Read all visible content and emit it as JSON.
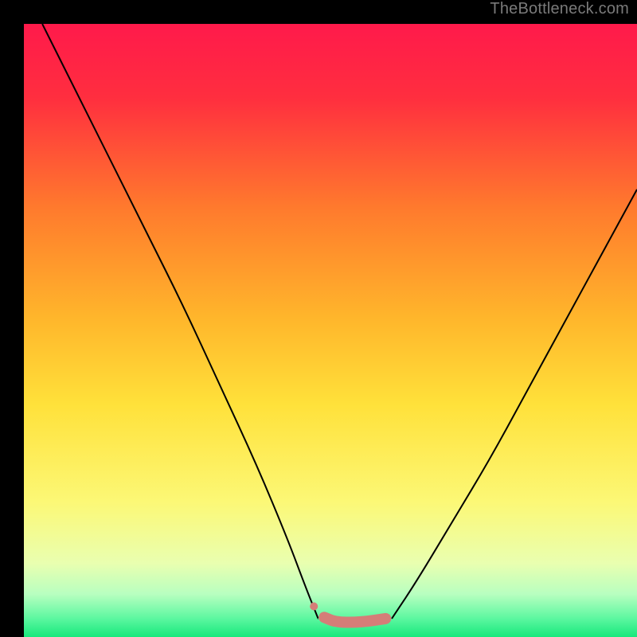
{
  "watermark": "TheBottleneck.com",
  "chart_data": {
    "type": "line",
    "title": "",
    "xlabel": "",
    "ylabel": "",
    "xlim": [
      0,
      100
    ],
    "ylim": [
      0,
      100
    ],
    "background_gradient": {
      "stops": [
        {
          "pct": 0,
          "color": "#ff1a4b"
        },
        {
          "pct": 12,
          "color": "#ff2e3f"
        },
        {
          "pct": 30,
          "color": "#ff7a2d"
        },
        {
          "pct": 48,
          "color": "#ffb62b"
        },
        {
          "pct": 62,
          "color": "#ffe13a"
        },
        {
          "pct": 78,
          "color": "#fcf876"
        },
        {
          "pct": 88,
          "color": "#e9ffb0"
        },
        {
          "pct": 93,
          "color": "#b8ffc0"
        },
        {
          "pct": 97,
          "color": "#5cf7a0"
        },
        {
          "pct": 100,
          "color": "#17e87c"
        }
      ]
    },
    "series": [
      {
        "name": "left-curve",
        "stroke": "#000000",
        "points": [
          {
            "x": 3,
            "y": 100
          },
          {
            "x": 8,
            "y": 90
          },
          {
            "x": 14,
            "y": 78
          },
          {
            "x": 20,
            "y": 66
          },
          {
            "x": 26,
            "y": 54
          },
          {
            "x": 32,
            "y": 41
          },
          {
            "x": 38,
            "y": 28
          },
          {
            "x": 43,
            "y": 16
          },
          {
            "x": 46,
            "y": 8
          },
          {
            "x": 48,
            "y": 3
          }
        ]
      },
      {
        "name": "right-curve",
        "stroke": "#000000",
        "points": [
          {
            "x": 60,
            "y": 3
          },
          {
            "x": 64,
            "y": 9
          },
          {
            "x": 70,
            "y": 19
          },
          {
            "x": 76,
            "y": 29
          },
          {
            "x": 82,
            "y": 40
          },
          {
            "x": 88,
            "y": 51
          },
          {
            "x": 94,
            "y": 62
          },
          {
            "x": 100,
            "y": 73
          }
        ]
      },
      {
        "name": "flat-segment",
        "stroke": "#d57d78",
        "stroke_width": 14,
        "linecap": "round",
        "points": [
          {
            "x": 49,
            "y": 3.2
          },
          {
            "x": 51,
            "y": 2.4
          },
          {
            "x": 55,
            "y": 2.4
          },
          {
            "x": 59,
            "y": 3.0
          }
        ]
      },
      {
        "name": "flat-segment-dot",
        "stroke": "#d57d78",
        "type_marker": "circle",
        "radius": 5,
        "points": [
          {
            "x": 47.3,
            "y": 5.0
          }
        ]
      }
    ]
  }
}
